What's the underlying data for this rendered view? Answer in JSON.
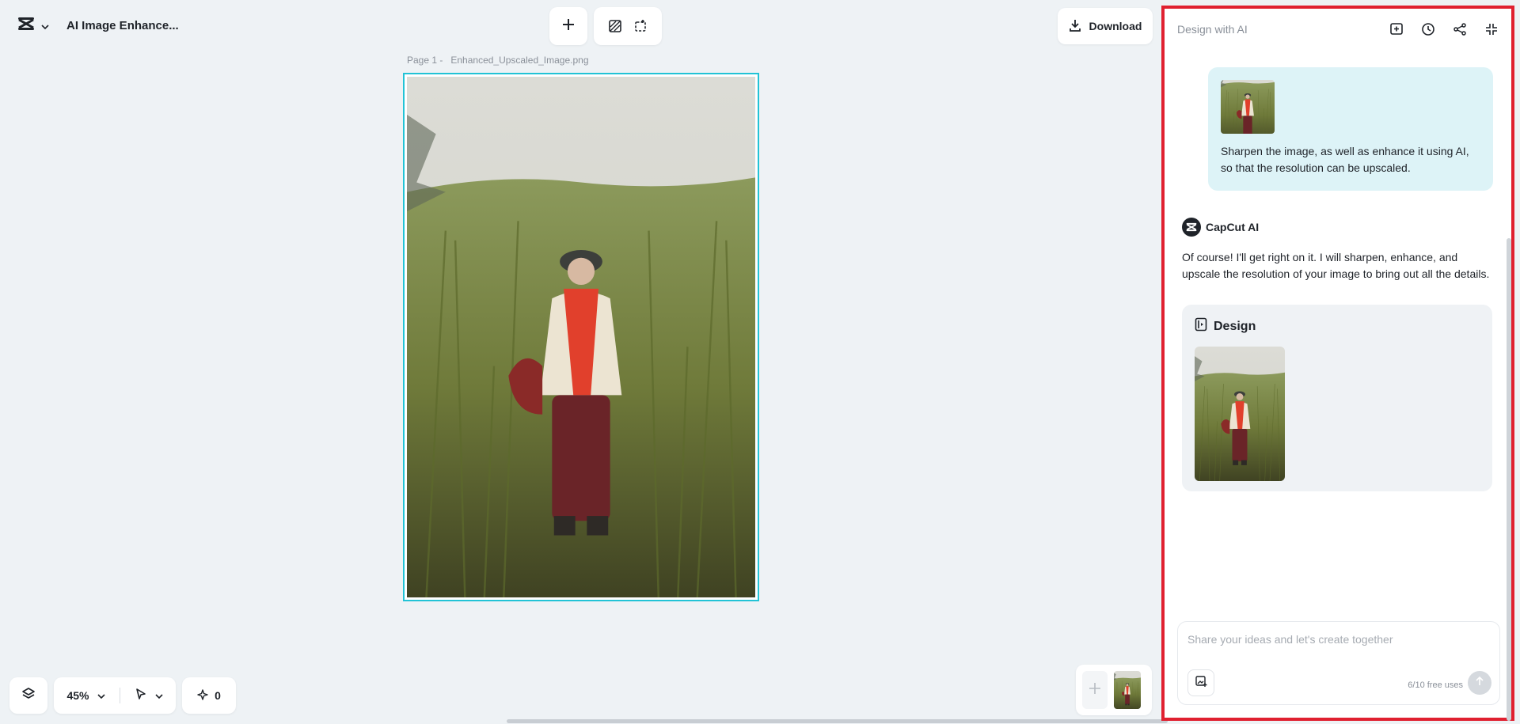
{
  "app": {
    "title": "AI Image Enhance..."
  },
  "toolbar": {
    "add_icon": "plus-icon",
    "tool_icons": [
      "background-remove-icon",
      "resize-icon"
    ]
  },
  "download": {
    "label": "Download",
    "icon": "download-icon"
  },
  "canvas": {
    "page_label": "Page 1 -   Enhanced_Upscaled_Image.png"
  },
  "bottom_bar": {
    "layers_icon": "layers-icon",
    "zoom": "45%",
    "pointer_icon": "pointer-icon",
    "credits": "0"
  },
  "panel": {
    "title": "Design with AI",
    "actions": [
      "new-chat-icon",
      "history-icon",
      "share-icon",
      "collapse-icon"
    ],
    "user_message": "Sharpen the image, as well as enhance it using AI, so that the resolution can be upscaled.",
    "ai_name": "CapCut AI",
    "ai_message": "Of course! I'll get right on it. I will sharpen, enhance, and upscale the resolution of your image to bring out all the details.",
    "design_card_title": "Design",
    "input_placeholder": "Share your ideas and let's create together",
    "free_uses": "6/10 free uses"
  },
  "colors": {
    "selection_border": "#22c3d6",
    "panel_highlight": "#e02030",
    "user_bubble": "#ddf3f7",
    "background": "#eef2f5"
  }
}
